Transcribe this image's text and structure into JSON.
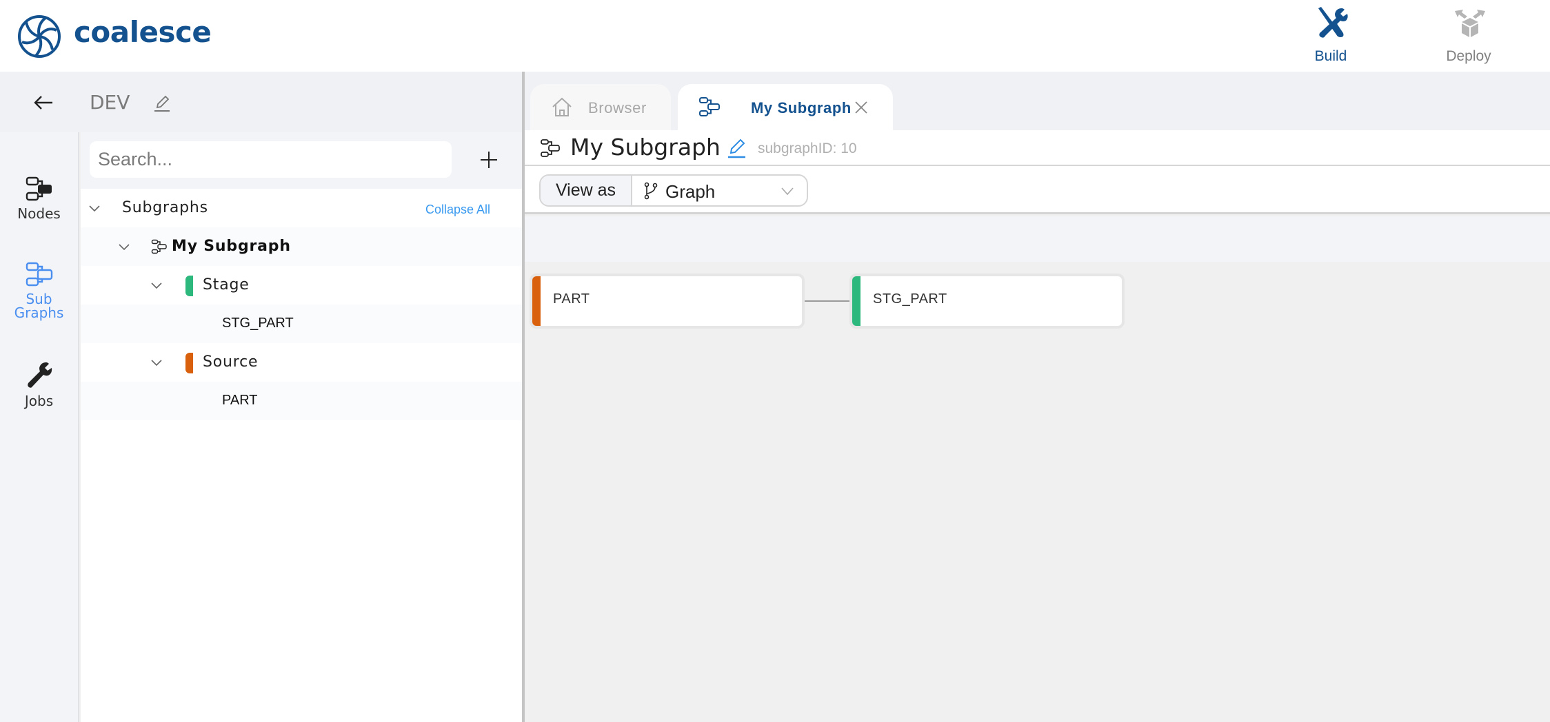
{
  "app": {
    "brand": "coalesce",
    "brand_color": "#14528f"
  },
  "top_tabs": [
    {
      "label": "Build",
      "icon": "build-tools-icon",
      "active": true,
      "color": "#14528f"
    },
    {
      "label": "Deploy",
      "icon": "deploy-box-icon",
      "active": false,
      "color": "#808080"
    }
  ],
  "environment": {
    "name": "DEV",
    "back_icon": "arrow-left-icon",
    "edit_icon": "pencil-icon"
  },
  "left_nav": [
    {
      "label": "Nodes",
      "icon": "nodes-icon",
      "active": false
    },
    {
      "label": "Sub Graphs",
      "label_line1": "Sub",
      "label_line2": "Graphs",
      "icon": "subgraphs-icon",
      "active": true,
      "color": "#4a8ff0"
    },
    {
      "label": "Jobs",
      "icon": "wrench-icon",
      "active": false
    }
  ],
  "tree": {
    "search_placeholder": "Search...",
    "add_icon": "plus-icon",
    "root_label": "Subgraphs",
    "collapse_all": "Collapse All",
    "subgraph": "My Subgraph",
    "groups": [
      {
        "label": "Stage",
        "color": "#2db87d",
        "items": [
          "STG_PART"
        ]
      },
      {
        "label": "Source",
        "color": "#d9600c",
        "items": [
          "PART"
        ]
      }
    ]
  },
  "doc_tabs": [
    {
      "label": "Browser",
      "icon": "home-icon",
      "active": false
    },
    {
      "label": "My Subgraph",
      "icon": "subgraph-icon",
      "active": true,
      "closable": true
    }
  ],
  "subgraph_view": {
    "title": "My Subgraph",
    "id_text": "subgraphID: 10",
    "view_as_label": "View as",
    "view_as_value": "Graph",
    "edit_color": "#2f8de4"
  },
  "graph": {
    "nodes": [
      {
        "name": "PART",
        "type": "Source",
        "color": "#d9600c"
      },
      {
        "name": "STG_PART",
        "type": "Stage",
        "color": "#2db87d"
      }
    ],
    "edges": [
      {
        "from": "PART",
        "to": "STG_PART"
      }
    ]
  }
}
